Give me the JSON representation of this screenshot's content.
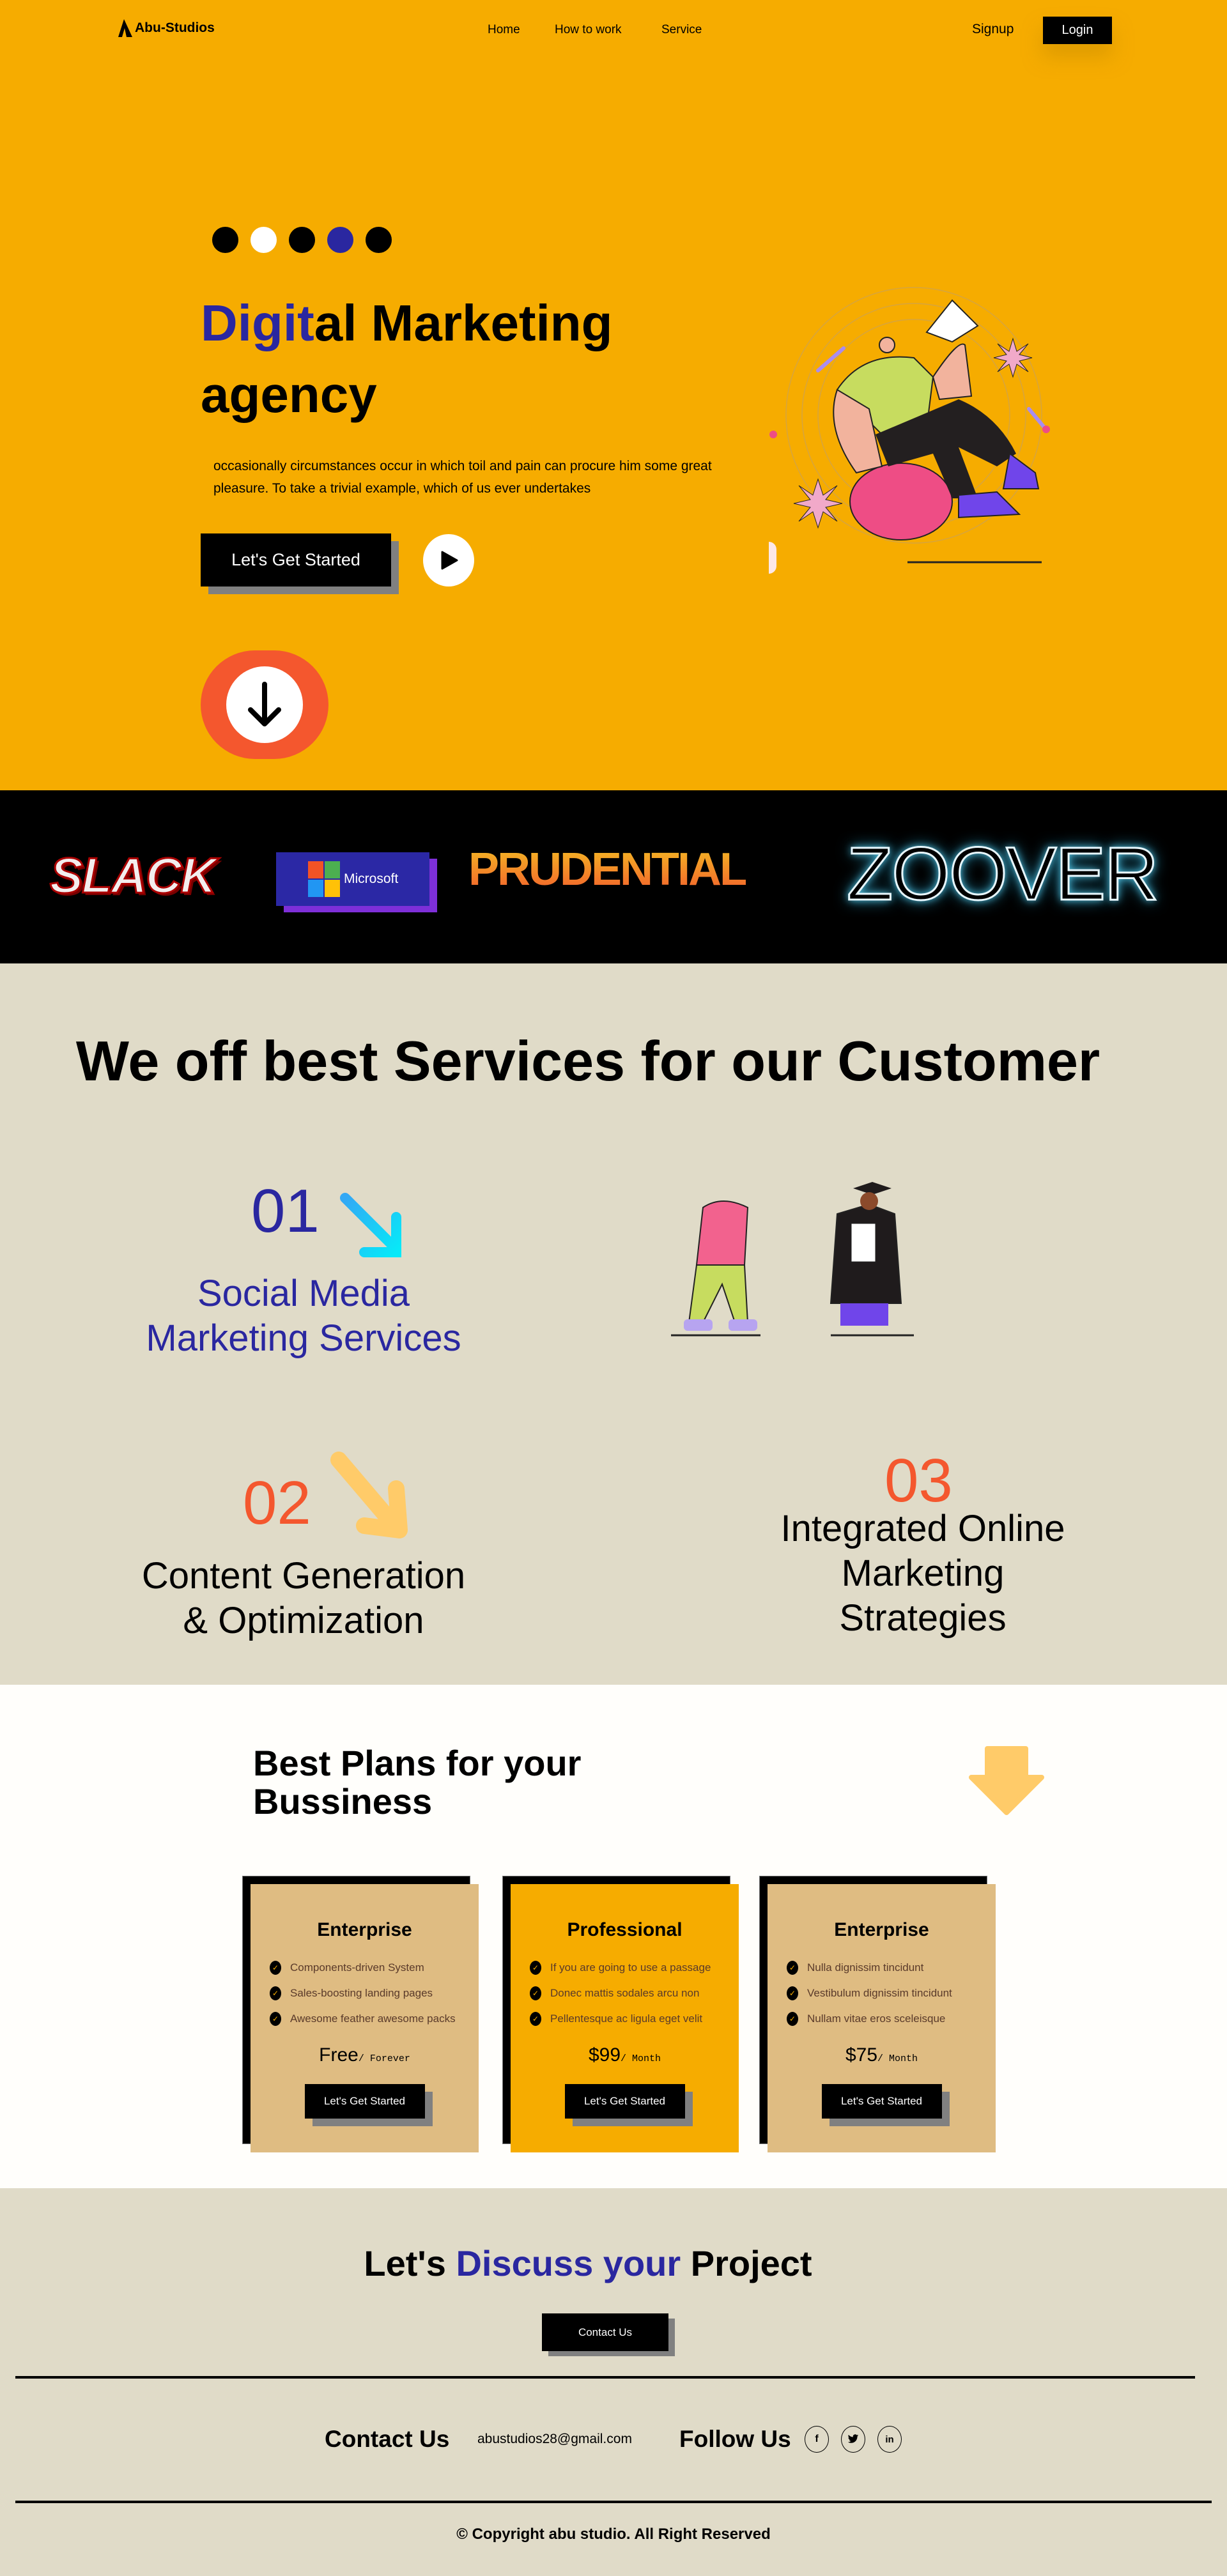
{
  "nav": {
    "brand": "Abu-Studios",
    "links": [
      "Home",
      "How to work",
      "Service"
    ],
    "signup": "Signup",
    "login": "Login"
  },
  "hero": {
    "title_highlight": "Digit",
    "title_rest": "al Marketing",
    "title_line2": "agency",
    "description": "occasionally circumstances occur in which toil and pain can procure him some great pleasure. To take a trivial example, which of us ever undertakes",
    "cta": "Let's Get Started",
    "colors": {
      "background": "#F6AC00",
      "accent": "#2A27A0",
      "orange": "#F4572E"
    }
  },
  "partners": [
    "SLACK",
    "Microsoft",
    "PRUDENTIAL",
    "ZOOVER"
  ],
  "services": {
    "title": "We off best Services for our Customer",
    "items": [
      {
        "num": "01",
        "line1": "Social Media",
        "line2": "Marketing Services"
      },
      {
        "num": "02",
        "line1": "Content Generation",
        "line2": "& Optimization"
      },
      {
        "num": "03",
        "line1": "Integrated Online",
        "line2": "Marketing",
        "line3": "Strategies"
      }
    ]
  },
  "plans": {
    "title_line1": "Best Plans for your",
    "title_line2": "Bussiness",
    "cards": [
      {
        "name": "Enterprise",
        "features": [
          "Components-driven System",
          "Sales-boosting landing pages",
          "Awesome feather awesome packs"
        ],
        "price": "Free",
        "period": "/ Forever",
        "cta": "Let's Get Started"
      },
      {
        "name": "Professional",
        "features": [
          "If you are going to use a passage",
          "Donec mattis sodales arcu non",
          "Pellentesque ac ligula eget velit"
        ],
        "price": "$99",
        "period": "/ Month",
        "cta": "Let's Get Started"
      },
      {
        "name": "Enterprise",
        "features": [
          "Nulla dignissim tincidunt",
          "Vestibulum dignissim tincidunt",
          "Nullam vitae eros sceleisque"
        ],
        "price": "$75",
        "period": "/ Month",
        "cta": "Let's Get Started"
      }
    ]
  },
  "discuss": {
    "pre": "Let's ",
    "highlight": "Discuss your",
    "post": " Project",
    "cta": "Contact Us"
  },
  "footer": {
    "contact_label": "Contact Us",
    "email": "abustudios28@gmail.com",
    "follow_label": "Follow Us",
    "social": [
      "facebook",
      "twitter",
      "linkedin"
    ],
    "copyright": "© Copyright abu studio. All Right Reserved"
  }
}
